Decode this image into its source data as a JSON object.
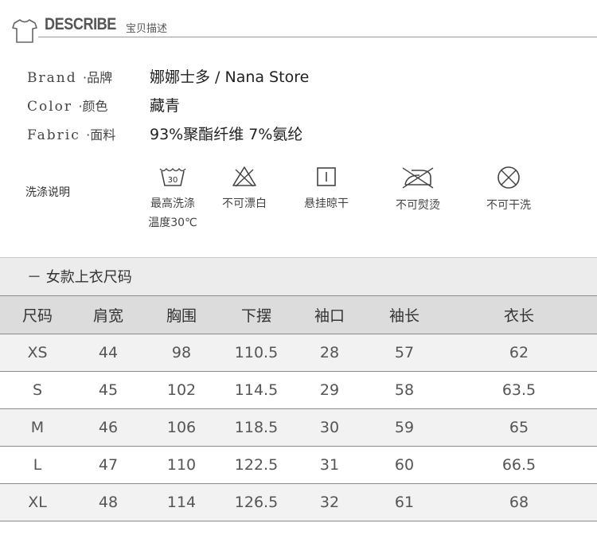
{
  "header": {
    "title": "DESCRIBE",
    "subtitle": "宝贝描述"
  },
  "info": [
    {
      "label_en": "Brand",
      "label_cn": "·品牌",
      "value": "娜娜士多 / Nana Store"
    },
    {
      "label_en": "Color",
      "label_cn": "·颜色",
      "value": "藏青"
    },
    {
      "label_en": "Fabric",
      "label_cn": "·面料",
      "value": "93%聚酯纤维 7%氨纶"
    }
  ],
  "care": {
    "title": "洗涤说明",
    "items": [
      {
        "icon": "wash-30-icon",
        "line1": "最高洗涤",
        "line2": "温度30℃",
        "wash_temp": "30"
      },
      {
        "icon": "no-bleach-icon",
        "line1": "不可漂白",
        "line2": ""
      },
      {
        "icon": "hang-dry-icon",
        "line1": "悬挂晾干",
        "line2": ""
      },
      {
        "icon": "no-iron-icon",
        "line1": "不可熨烫",
        "line2": ""
      },
      {
        "icon": "no-dryclean-icon",
        "line1": "不可干洗",
        "line2": ""
      }
    ]
  },
  "size_table": {
    "section_title": "－ 女款上衣尺码",
    "columns": [
      "尺码",
      "肩宽",
      "胸围",
      "下摆",
      "袖口",
      "袖长",
      "衣长"
    ],
    "rows": [
      [
        "XS",
        "44",
        "98",
        "110.5",
        "28",
        "57",
        "62"
      ],
      [
        "S",
        "45",
        "102",
        "114.5",
        "29",
        "58",
        "63.5"
      ],
      [
        "M",
        "46",
        "106",
        "118.5",
        "30",
        "59",
        "65"
      ],
      [
        "L",
        "47",
        "110",
        "122.5",
        "31",
        "60",
        "66.5"
      ],
      [
        "XL",
        "48",
        "114",
        "126.5",
        "32",
        "61",
        "68"
      ]
    ]
  }
}
